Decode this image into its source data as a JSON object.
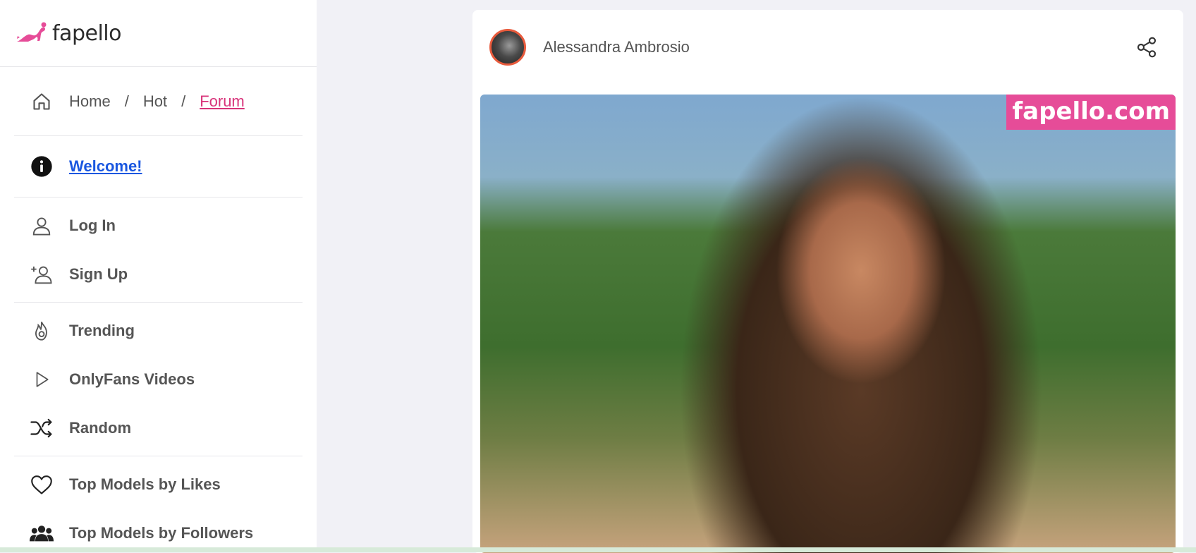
{
  "brand": {
    "name": "fapello",
    "accent": "#e64c98"
  },
  "sidebar": {
    "breadcrumb": {
      "items": [
        "Home",
        "Hot",
        "Forum"
      ],
      "separator": "/",
      "icon": "home-icon"
    },
    "welcome": {
      "label": "Welcome!",
      "icon": "info-icon"
    },
    "account": [
      {
        "label": "Log In",
        "icon": "user-icon"
      },
      {
        "label": "Sign Up",
        "icon": "user-plus-icon"
      }
    ],
    "browse": [
      {
        "label": "Trending",
        "icon": "fire-icon"
      },
      {
        "label": "OnlyFans Videos",
        "icon": "play-icon"
      },
      {
        "label": "Random",
        "icon": "shuffle-icon"
      }
    ],
    "rankings": [
      {
        "label": "Top Models by Likes",
        "icon": "heart-icon"
      },
      {
        "label": "Top Models by Followers",
        "icon": "users-icon"
      }
    ]
  },
  "post": {
    "author": "Alessandra Ambrosio",
    "share_icon": "share-icon",
    "watermark": "fapello.com"
  }
}
